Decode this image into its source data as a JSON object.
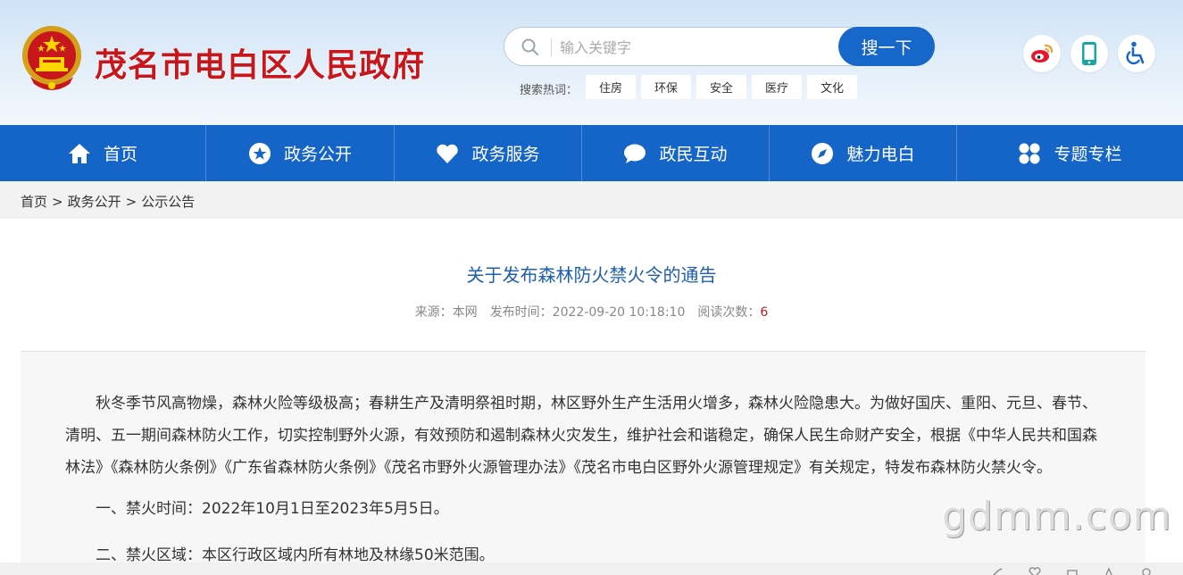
{
  "header": {
    "site_title": "茂名市电白区人民政府",
    "search": {
      "placeholder": "输入关键字",
      "button_label": "搜一下"
    },
    "hot_label": "搜索热词：",
    "hot_tags": [
      "住房",
      "环保",
      "安全",
      "医疗",
      "文化"
    ],
    "top_icons": [
      "weibo-icon",
      "mobile-icon",
      "accessibility-icon"
    ]
  },
  "nav": {
    "items": [
      {
        "label": "首页",
        "icon": "home-icon"
      },
      {
        "label": "政务公开",
        "icon": "star-icon"
      },
      {
        "label": "政务服务",
        "icon": "heart-icon"
      },
      {
        "label": "政民互动",
        "icon": "chat-icon"
      },
      {
        "label": "魅力电白",
        "icon": "compass-icon"
      },
      {
        "label": "专题专栏",
        "icon": "grid-icon"
      }
    ]
  },
  "breadcrumb": {
    "items": [
      "首页",
      "政务公开",
      "公示公告"
    ],
    "separator": ">"
  },
  "article": {
    "title": "关于发布森林防火禁火令的通告",
    "meta": {
      "source": "来源：本网",
      "published": "发布时间：2022-09-20 10:18:10",
      "read_label": "阅读次数：",
      "read_count": "6"
    },
    "paragraphs": [
      "秋冬季节风高物燥，森林火险等级极高；春耕生产及清明祭祖时期，林区野外生产生活用火增多，森林火险隐患大。为做好国庆、重阳、元旦、春节、清明、五一期间森林防火工作，切实控制野外火源，有效预防和遏制森林火灾发生，维护社会和谐稳定，确保人民生命财产安全，根据《中华人民共和国森林法》《森林防火条例》《广东省森林防火条例》《茂名市野外火源管理办法》《茂名市电白区野外火源管理规定》有关规定，特发布森林防火禁火令。",
      "一、禁火时间：2022年10月1日至2023年5月5日。",
      "二、禁火区域：本区行政区域内所有林地及林缘50米范围。"
    ]
  },
  "watermark": "gdmm.com",
  "colors": {
    "brand_red": "#c8161d",
    "nav_blue": "#1565c8",
    "title_blue": "#1d5fae",
    "read_count_red": "#b22222"
  }
}
